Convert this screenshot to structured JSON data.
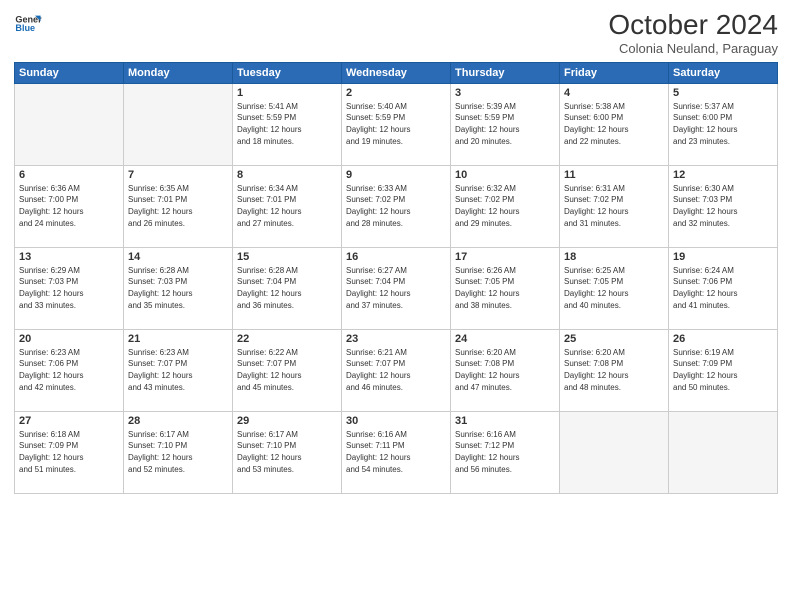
{
  "logo": {
    "line1": "General",
    "line2": "Blue"
  },
  "title": "October 2024",
  "subtitle": "Colonia Neuland, Paraguay",
  "days_header": [
    "Sunday",
    "Monday",
    "Tuesday",
    "Wednesday",
    "Thursday",
    "Friday",
    "Saturday"
  ],
  "weeks": [
    [
      {
        "num": "",
        "info": ""
      },
      {
        "num": "",
        "info": ""
      },
      {
        "num": "1",
        "info": "Sunrise: 5:41 AM\nSunset: 5:59 PM\nDaylight: 12 hours\nand 18 minutes."
      },
      {
        "num": "2",
        "info": "Sunrise: 5:40 AM\nSunset: 5:59 PM\nDaylight: 12 hours\nand 19 minutes."
      },
      {
        "num": "3",
        "info": "Sunrise: 5:39 AM\nSunset: 5:59 PM\nDaylight: 12 hours\nand 20 minutes."
      },
      {
        "num": "4",
        "info": "Sunrise: 5:38 AM\nSunset: 6:00 PM\nDaylight: 12 hours\nand 22 minutes."
      },
      {
        "num": "5",
        "info": "Sunrise: 5:37 AM\nSunset: 6:00 PM\nDaylight: 12 hours\nand 23 minutes."
      }
    ],
    [
      {
        "num": "6",
        "info": "Sunrise: 6:36 AM\nSunset: 7:00 PM\nDaylight: 12 hours\nand 24 minutes."
      },
      {
        "num": "7",
        "info": "Sunrise: 6:35 AM\nSunset: 7:01 PM\nDaylight: 12 hours\nand 26 minutes."
      },
      {
        "num": "8",
        "info": "Sunrise: 6:34 AM\nSunset: 7:01 PM\nDaylight: 12 hours\nand 27 minutes."
      },
      {
        "num": "9",
        "info": "Sunrise: 6:33 AM\nSunset: 7:02 PM\nDaylight: 12 hours\nand 28 minutes."
      },
      {
        "num": "10",
        "info": "Sunrise: 6:32 AM\nSunset: 7:02 PM\nDaylight: 12 hours\nand 29 minutes."
      },
      {
        "num": "11",
        "info": "Sunrise: 6:31 AM\nSunset: 7:02 PM\nDaylight: 12 hours\nand 31 minutes."
      },
      {
        "num": "12",
        "info": "Sunrise: 6:30 AM\nSunset: 7:03 PM\nDaylight: 12 hours\nand 32 minutes."
      }
    ],
    [
      {
        "num": "13",
        "info": "Sunrise: 6:29 AM\nSunset: 7:03 PM\nDaylight: 12 hours\nand 33 minutes."
      },
      {
        "num": "14",
        "info": "Sunrise: 6:28 AM\nSunset: 7:03 PM\nDaylight: 12 hours\nand 35 minutes."
      },
      {
        "num": "15",
        "info": "Sunrise: 6:28 AM\nSunset: 7:04 PM\nDaylight: 12 hours\nand 36 minutes."
      },
      {
        "num": "16",
        "info": "Sunrise: 6:27 AM\nSunset: 7:04 PM\nDaylight: 12 hours\nand 37 minutes."
      },
      {
        "num": "17",
        "info": "Sunrise: 6:26 AM\nSunset: 7:05 PM\nDaylight: 12 hours\nand 38 minutes."
      },
      {
        "num": "18",
        "info": "Sunrise: 6:25 AM\nSunset: 7:05 PM\nDaylight: 12 hours\nand 40 minutes."
      },
      {
        "num": "19",
        "info": "Sunrise: 6:24 AM\nSunset: 7:06 PM\nDaylight: 12 hours\nand 41 minutes."
      }
    ],
    [
      {
        "num": "20",
        "info": "Sunrise: 6:23 AM\nSunset: 7:06 PM\nDaylight: 12 hours\nand 42 minutes."
      },
      {
        "num": "21",
        "info": "Sunrise: 6:23 AM\nSunset: 7:07 PM\nDaylight: 12 hours\nand 43 minutes."
      },
      {
        "num": "22",
        "info": "Sunrise: 6:22 AM\nSunset: 7:07 PM\nDaylight: 12 hours\nand 45 minutes."
      },
      {
        "num": "23",
        "info": "Sunrise: 6:21 AM\nSunset: 7:07 PM\nDaylight: 12 hours\nand 46 minutes."
      },
      {
        "num": "24",
        "info": "Sunrise: 6:20 AM\nSunset: 7:08 PM\nDaylight: 12 hours\nand 47 minutes."
      },
      {
        "num": "25",
        "info": "Sunrise: 6:20 AM\nSunset: 7:08 PM\nDaylight: 12 hours\nand 48 minutes."
      },
      {
        "num": "26",
        "info": "Sunrise: 6:19 AM\nSunset: 7:09 PM\nDaylight: 12 hours\nand 50 minutes."
      }
    ],
    [
      {
        "num": "27",
        "info": "Sunrise: 6:18 AM\nSunset: 7:09 PM\nDaylight: 12 hours\nand 51 minutes."
      },
      {
        "num": "28",
        "info": "Sunrise: 6:17 AM\nSunset: 7:10 PM\nDaylight: 12 hours\nand 52 minutes."
      },
      {
        "num": "29",
        "info": "Sunrise: 6:17 AM\nSunset: 7:10 PM\nDaylight: 12 hours\nand 53 minutes."
      },
      {
        "num": "30",
        "info": "Sunrise: 6:16 AM\nSunset: 7:11 PM\nDaylight: 12 hours\nand 54 minutes."
      },
      {
        "num": "31",
        "info": "Sunrise: 6:16 AM\nSunset: 7:12 PM\nDaylight: 12 hours\nand 56 minutes."
      },
      {
        "num": "",
        "info": ""
      },
      {
        "num": "",
        "info": ""
      }
    ]
  ]
}
